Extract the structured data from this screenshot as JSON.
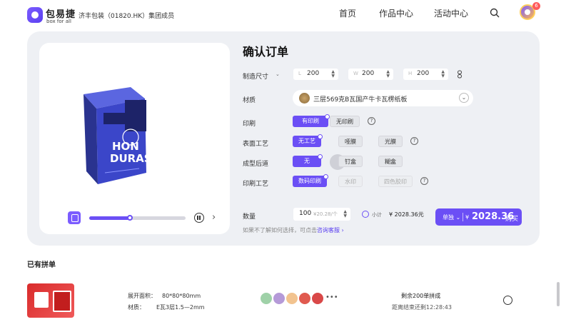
{
  "header": {
    "logo_text": "包易捷",
    "logo_sub": "box for all",
    "company": "济丰包装（01820.HK）集团成员",
    "nav": [
      "首页",
      "作品中心",
      "活动中心"
    ],
    "badge_count": "6"
  },
  "product": {
    "box_lines": [
      "HON",
      "DURAS"
    ],
    "progress": 0.42
  },
  "order": {
    "title": "确认订单",
    "size_label": "制造尺寸",
    "dims": [
      {
        "label": "L",
        "value": "200"
      },
      {
        "label": "W",
        "value": "200"
      },
      {
        "label": "H",
        "value": "200"
      }
    ],
    "material_label": "材质",
    "material_value": "三层569克B瓦国产牛卡瓦楞纸板",
    "print_label": "印刷",
    "print_options": [
      "有印刷",
      "无印刷"
    ],
    "surface_label": "表面工艺",
    "surface_options": [
      "无工艺",
      "哑膜",
      "光膜"
    ],
    "post_label": "成型后道",
    "post_options": [
      "无",
      "钉盒",
      "糊盒"
    ],
    "printing_label": "印刷工艺",
    "printing_options": [
      "数码印刷",
      "水印",
      "四色胶印"
    ],
    "qty_label": "数量",
    "qty_value": "100",
    "qty_unit": "¥20.28/个",
    "subtotal_label": "小计",
    "subtotal_value": "¥ 2028.36元",
    "buy_mode": "单独",
    "buy_currency": "¥",
    "buy_price": "2028.36",
    "buy_label": "购买",
    "consult_text": "如果不了解如何选择，可点击",
    "consult_link": "咨询客服"
  },
  "group": {
    "title": "已有拼单",
    "area_label": "展开面积：",
    "area_value": "80*80*80mm",
    "material_label": "材质：",
    "material_value": "E瓦3层1.5—2mm",
    "remain": "剩余200单拼成",
    "countdown": "距离结束还剩12:28:43",
    "avatar_colors": [
      "#9fd1a8",
      "#b59ad8",
      "#f2c38f",
      "#e05a4f",
      "#d94848"
    ]
  },
  "colors": {
    "accent": "#6b4ff5",
    "box_blue": "#3b46c9",
    "card_bg": "#eef0f4"
  }
}
